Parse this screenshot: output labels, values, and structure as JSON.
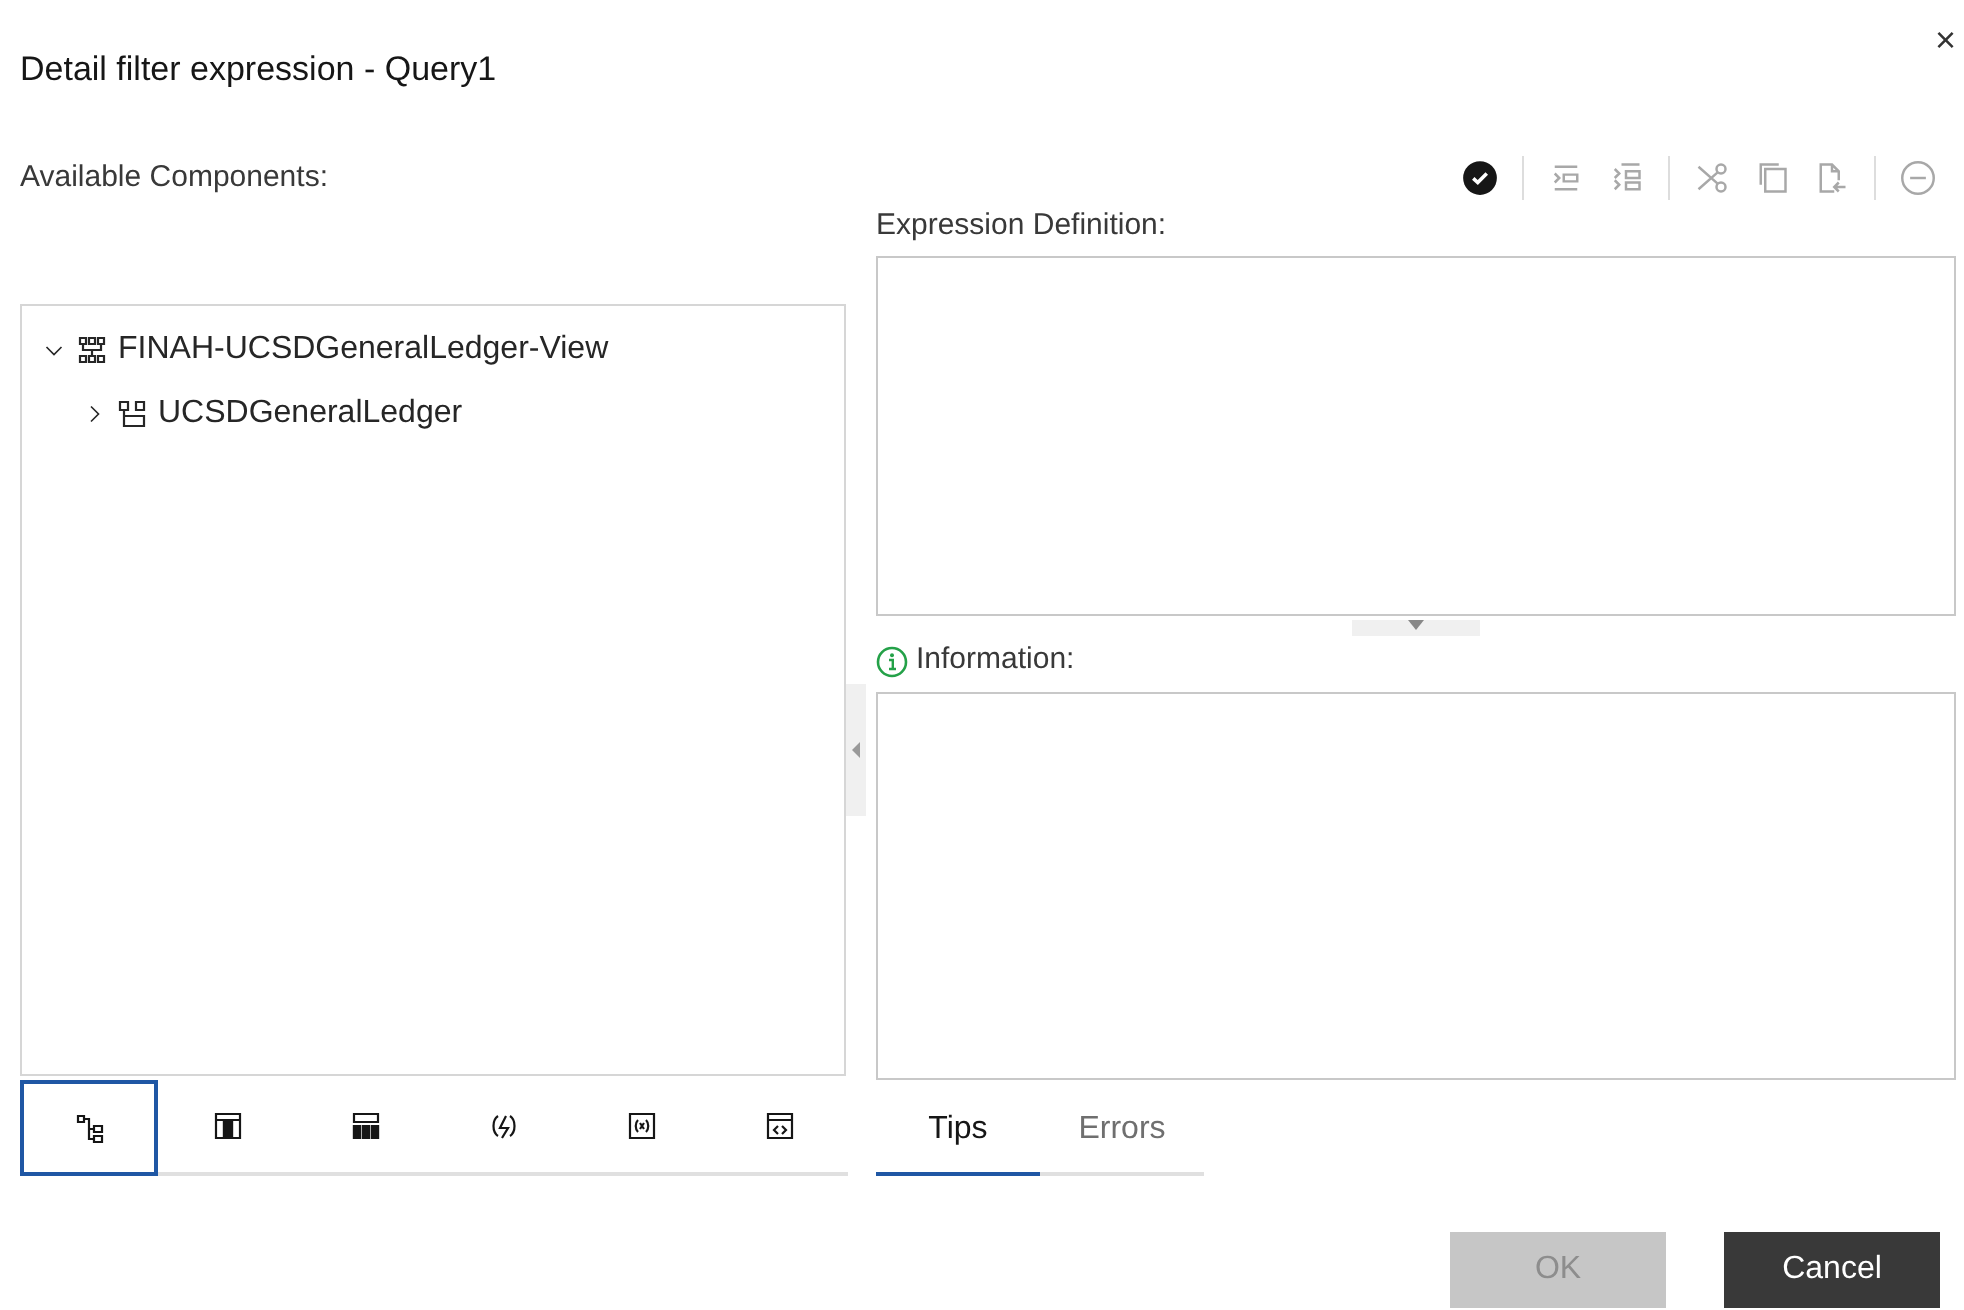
{
  "dialog": {
    "title": "Detail filter expression - Query1",
    "close": "×"
  },
  "components_label": "Available Components:",
  "toolbar": [
    {
      "kind": "validate",
      "disabled": false
    },
    {
      "kind": "sep"
    },
    {
      "kind": "indent",
      "disabled": true
    },
    {
      "kind": "outdent",
      "disabled": true
    },
    {
      "kind": "sep"
    },
    {
      "kind": "cut",
      "disabled": true
    },
    {
      "kind": "copy",
      "disabled": true
    },
    {
      "kind": "paste",
      "disabled": true
    },
    {
      "kind": "sep"
    },
    {
      "kind": "remove",
      "disabled": true
    }
  ],
  "tree": [
    {
      "label": "FINAH-UCSDGeneralLedger-View",
      "kind": "package",
      "expanded": true,
      "children": [
        {
          "label": "UCSDGeneralLedger",
          "kind": "namespace",
          "expanded": false
        }
      ]
    }
  ],
  "source_tabs": [
    {
      "kind": "model",
      "selected": true
    },
    {
      "kind": "data-items",
      "selected": false
    },
    {
      "kind": "query-items",
      "selected": false
    },
    {
      "kind": "functions",
      "selected": false
    },
    {
      "kind": "parameters",
      "selected": false
    },
    {
      "kind": "macros",
      "selected": false
    }
  ],
  "expression_label": "Expression Definition:",
  "information_label": "Information:",
  "info_tabs": [
    {
      "label": "Tips",
      "selected": true
    },
    {
      "label": "Errors",
      "selected": false
    }
  ],
  "buttons": [
    {
      "label": "OK",
      "kind": "primary",
      "disabled": true
    },
    {
      "label": "Cancel",
      "kind": "secondary",
      "disabled": false
    }
  ]
}
